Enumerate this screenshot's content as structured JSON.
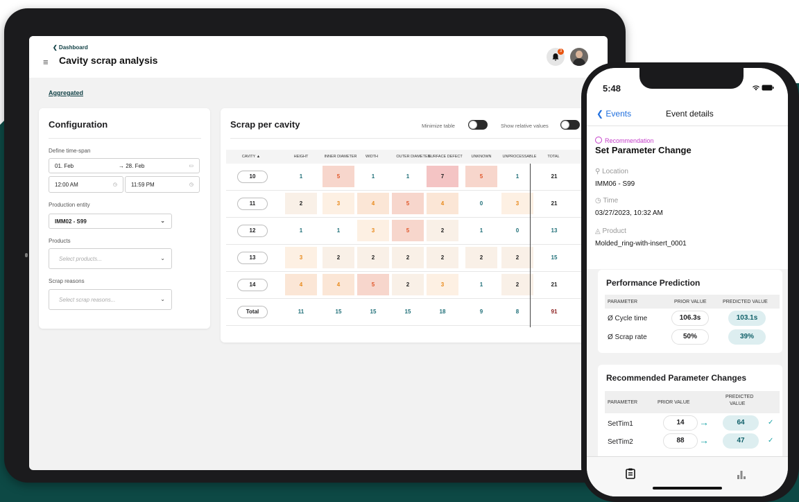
{
  "colors": {
    "accent": "#0f3f44",
    "teal": "#1aa0a7",
    "brand_bg": "#0d4945",
    "recommendation": "#c43dc9",
    "ios_blue": "#1f6fde"
  },
  "tablet": {
    "header": {
      "back_label": "❮ Dashboard",
      "title": "Cavity scrap analysis",
      "notifications_count": "3"
    },
    "aggregated_link": "Aggregated",
    "config": {
      "title": "Configuration",
      "timespan_label": "Define time-span",
      "date_from": "01. Feb",
      "date_to": "→ 28. Feb",
      "time_from": "12:00 AM",
      "time_to": "11:59 PM",
      "entity_label": "Production entity",
      "entity_value": "IMM02 - S99",
      "products_label": "Products",
      "products_placeholder": "Select products...",
      "reasons_label": "Scrap reasons",
      "reasons_placeholder": "Select scrap reasons..."
    },
    "scrap": {
      "title": "Scrap per cavity",
      "minimize_label": "Minimize table",
      "relative_label": "Show relative values",
      "columns": [
        "CAVITY ▲",
        "HEIGHT",
        "INNER DIAMETER",
        "WIDTH",
        "OUTER DIAMETER",
        "SURFACE DEFECT",
        "UNKNOWN",
        "UNPROCESSABLE",
        "TOTAL"
      ],
      "rows": [
        {
          "cavity": "10",
          "values": [
            "1",
            "5",
            "1",
            "1",
            "7",
            "5",
            "1"
          ],
          "total": "21"
        },
        {
          "cavity": "11",
          "values": [
            "2",
            "3",
            "4",
            "5",
            "4",
            "0",
            "3"
          ],
          "total": "21"
        },
        {
          "cavity": "12",
          "values": [
            "1",
            "1",
            "3",
            "5",
            "2",
            "1",
            "0"
          ],
          "total": "13"
        },
        {
          "cavity": "13",
          "values": [
            "3",
            "2",
            "2",
            "2",
            "2",
            "2",
            "2"
          ],
          "total": "15"
        },
        {
          "cavity": "14",
          "values": [
            "4",
            "4",
            "5",
            "2",
            "3",
            "1",
            "2"
          ],
          "total": "21"
        }
      ],
      "totals": {
        "label": "Total",
        "values": [
          "11",
          "15",
          "15",
          "15",
          "18",
          "9",
          "8"
        ],
        "total": "91"
      }
    }
  },
  "phone": {
    "time": "5:48",
    "status_icons": "wifi-icon battery-icon",
    "nav": {
      "back": "❮ Events",
      "title": "Event details"
    },
    "event": {
      "type": "Recommendation",
      "title": "Set Parameter Change",
      "location_label": "⚲ Location",
      "location": "IMM06 - S99",
      "time_label": "◷ Time",
      "time": "03/27/2023, 10:32 AM",
      "product_label": "◬ Product",
      "product": "Molded_ring-with-insert_0001"
    },
    "performance": {
      "title": "Performance Prediction",
      "headers": [
        "PARAMETER",
        "PRIOR VALUE",
        "PREDICTED VALUE"
      ],
      "rows": [
        {
          "param": "Ø Cycle time",
          "prior": "106.3s",
          "predicted": "103.1s"
        },
        {
          "param": "Ø Scrap rate",
          "prior": "50%",
          "predicted": "39%"
        }
      ]
    },
    "changes": {
      "title": "Recommended Parameter Changes",
      "headers": [
        "PARAMETER",
        "PRIOR VALUE",
        "PREDICTED",
        "VALUE"
      ],
      "rows": [
        {
          "param": "SetTim1",
          "prior": "14",
          "predicted": "64"
        },
        {
          "param": "SetTim2",
          "prior": "88",
          "predicted": "47"
        }
      ]
    }
  }
}
